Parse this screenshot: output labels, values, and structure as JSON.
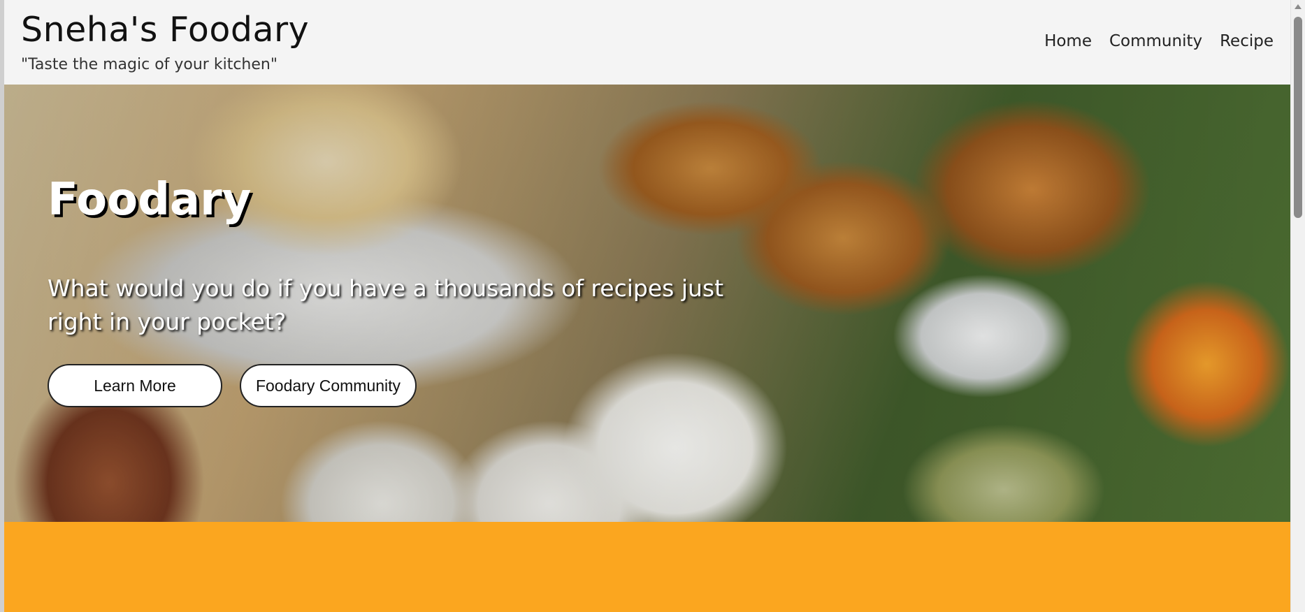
{
  "header": {
    "title": "Sneha's Foodary",
    "tagline": "\"Taste the magic of your kitchen\"",
    "nav": [
      {
        "label": "Home"
      },
      {
        "label": "Community"
      },
      {
        "label": "Recipe"
      }
    ]
  },
  "hero": {
    "title": "Foodary",
    "subtitle": "What would you do if you have a thousands of recipes just right in your pocket?",
    "buttons": {
      "learn_more": "Learn More",
      "community": "Foodary Community"
    }
  },
  "colors": {
    "header_bg": "#f4f4f4",
    "accent_band": "#fba61f",
    "button_bg": "#ffffff",
    "hero_text": "#ffffff"
  },
  "icons": [
    "scrollbar-up-arrow-icon"
  ]
}
